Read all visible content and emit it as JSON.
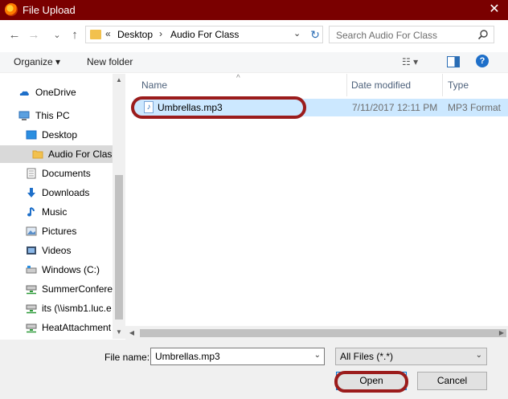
{
  "window": {
    "title": "File Upload",
    "close_glyph": "✕"
  },
  "nav": {
    "back_glyph": "←",
    "forward_glyph": "→",
    "recent_glyph": "⌄",
    "up_glyph": "↑",
    "breadcrumb": {
      "overflow": "«",
      "items": [
        "Desktop",
        "Audio For Class"
      ],
      "separator": "›",
      "dropdown_glyph": "⌄"
    },
    "refresh_glyph": "↻",
    "search_placeholder": "Search Audio For Class"
  },
  "toolbar": {
    "organize": "Organize ▾",
    "new_folder": "New folder",
    "view_glyph": "☷ ▾",
    "help_glyph": "?"
  },
  "sidebar": {
    "items": [
      {
        "label": "OneDrive",
        "icon": "onedrive-icon"
      },
      {
        "label": "This PC",
        "icon": "computer-icon"
      },
      {
        "label": "Desktop",
        "icon": "desktop-icon"
      },
      {
        "label": "Audio For Clas",
        "icon": "folder-icon",
        "selected": true
      },
      {
        "label": "Documents",
        "icon": "documents-icon"
      },
      {
        "label": "Downloads",
        "icon": "downloads-icon"
      },
      {
        "label": "Music",
        "icon": "music-icon"
      },
      {
        "label": "Pictures",
        "icon": "pictures-icon"
      },
      {
        "label": "Videos",
        "icon": "videos-icon"
      },
      {
        "label": "Windows (C:)",
        "icon": "drive-icon"
      },
      {
        "label": "SummerConfere",
        "icon": "network-drive-icon"
      },
      {
        "label": "its (\\\\ismb1.luc.e",
        "icon": "network-drive-icon"
      },
      {
        "label": "HeatAttachment",
        "icon": "network-drive-icon"
      }
    ]
  },
  "columns": {
    "name": "Name",
    "date_modified": "Date modified",
    "type": "Type",
    "sort_glyph": "^"
  },
  "files": [
    {
      "name": "Umbrellas.mp3",
      "date": "7/11/2017 12:11 PM",
      "type": "MP3 Format",
      "icon_glyph": "♪"
    }
  ],
  "scroll": {
    "up": "▲",
    "down": "▼",
    "left": "◀",
    "right": "▶"
  },
  "footer": {
    "file_name_label": "File name:",
    "file_name_value": "Umbrellas.mp3",
    "filter_value": "All Files (*.*)",
    "dropdown_glyph": "⌄",
    "open_label": "Open",
    "cancel_label": "Cancel"
  },
  "colors": {
    "titlebar": "#7a0000",
    "selection": "#cce8ff",
    "annotation": "#9b1c1c"
  }
}
